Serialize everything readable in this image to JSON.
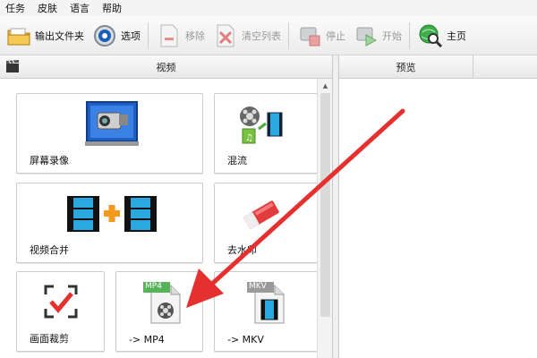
{
  "menu": [
    "任务",
    "皮肤",
    "语言",
    "帮助"
  ],
  "toolbar": {
    "output_folder": "输出文件夹",
    "options": "选项",
    "remove": "移除",
    "clear_list": "清空列表",
    "stop": "停止",
    "start": "开始",
    "home": "主页"
  },
  "left_panel": {
    "title": "视频"
  },
  "tiles": {
    "screen_record": "屏幕录像",
    "mix": "混流",
    "video_merge": "视频合并",
    "watermark": "去水印",
    "crop": "画面裁剪",
    "to_mp4": "-> MP4",
    "to_mkv": "-> MKV",
    "mp4_badge": "MP4",
    "mkv_badge": "MKV"
  },
  "right_panel": {
    "preview": "预览"
  },
  "colors": {
    "accent_red": "#e53030",
    "toolbar_bg": "#f0f0f0",
    "film_blue": "#2aa8e0",
    "plus_orange": "#f39a1e"
  }
}
